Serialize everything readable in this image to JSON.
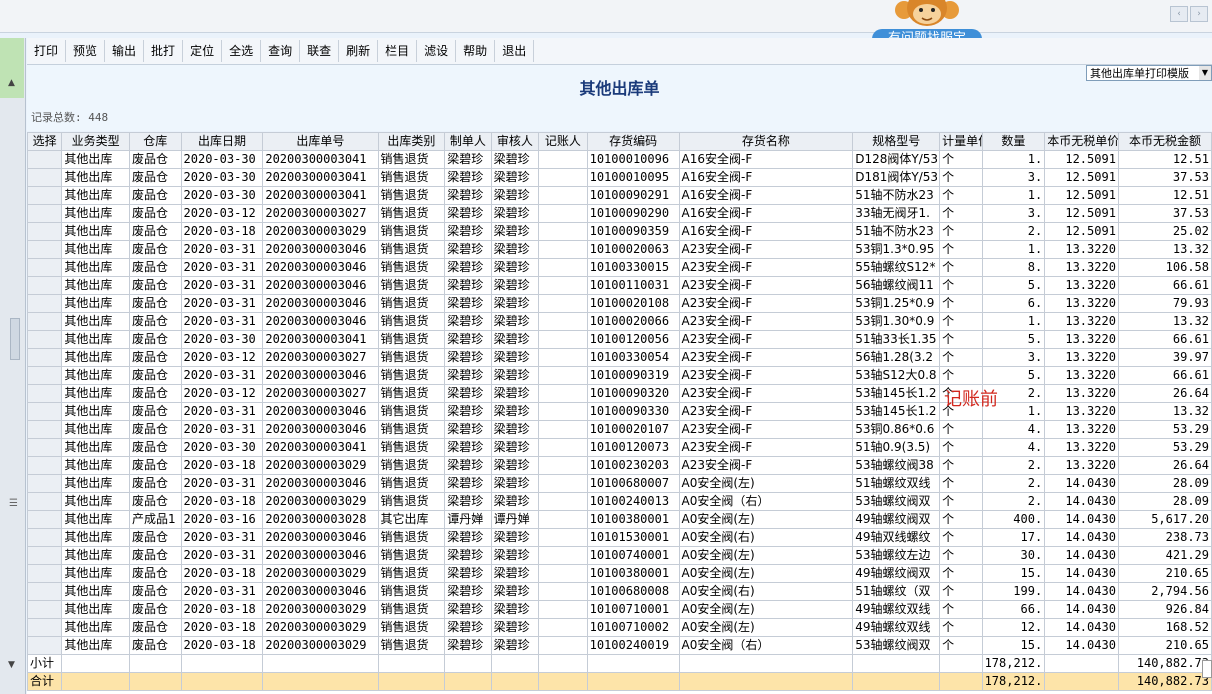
{
  "app": {
    "help_label": "有问题找服宝",
    "nav_prev": "‹",
    "nav_next": "›"
  },
  "toolbar": {
    "buttons": [
      "打印",
      "预览",
      "输出",
      "批打",
      "定位",
      "全选",
      "查询",
      "联查",
      "刷新",
      "栏目",
      "滤设",
      "帮助",
      "退出"
    ]
  },
  "report": {
    "title": "其他出库单",
    "template": "其他出库单打印模版",
    "record_count": "记录总数: 448"
  },
  "table": {
    "columns": [
      "选择",
      "业务类型",
      "仓库",
      "出库日期",
      "出库单号",
      "出库类别",
      "制单人",
      "审核人",
      "记账人",
      "存货编码",
      "存货名称",
      "规格型号",
      "计量单位",
      "数量",
      "本币无税单价",
      "本币无税金额"
    ],
    "rows": [
      [
        "",
        "其他出库",
        "废品仓",
        "2020-03-30",
        "20200300003041",
        "销售退货",
        "梁碧珍",
        "梁碧珍",
        "",
        "10100010096",
        "A16安全阀-F",
        "D128阀体Y/53",
        "个",
        "1.",
        "12.5091",
        "12.51"
      ],
      [
        "",
        "其他出库",
        "废品仓",
        "2020-03-30",
        "20200300003041",
        "销售退货",
        "梁碧珍",
        "梁碧珍",
        "",
        "10100010095",
        "A16安全阀-F",
        "D181阀体Y/53",
        "个",
        "3.",
        "12.5091",
        "37.53"
      ],
      [
        "",
        "其他出库",
        "废品仓",
        "2020-03-30",
        "20200300003041",
        "销售退货",
        "梁碧珍",
        "梁碧珍",
        "",
        "10100090291",
        "A16安全阀-F",
        "51轴不防水23",
        "个",
        "1.",
        "12.5091",
        "12.51"
      ],
      [
        "",
        "其他出库",
        "废品仓",
        "2020-03-12",
        "20200300003027",
        "销售退货",
        "梁碧珍",
        "梁碧珍",
        "",
        "10100090290",
        "A16安全阀-F",
        "33轴无阀牙1.",
        "个",
        "3.",
        "12.5091",
        "37.53"
      ],
      [
        "",
        "其他出库",
        "废品仓",
        "2020-03-18",
        "20200300003029",
        "销售退货",
        "梁碧珍",
        "梁碧珍",
        "",
        "10100090359",
        "A16安全阀-F",
        "51轴不防水23",
        "个",
        "2.",
        "12.5091",
        "25.02"
      ],
      [
        "",
        "其他出库",
        "废品仓",
        "2020-03-31",
        "20200300003046",
        "销售退货",
        "梁碧珍",
        "梁碧珍",
        "",
        "10100020063",
        "A23安全阀-F",
        "53铜1.3*0.95",
        "个",
        "1.",
        "13.3220",
        "13.32"
      ],
      [
        "",
        "其他出库",
        "废品仓",
        "2020-03-31",
        "20200300003046",
        "销售退货",
        "梁碧珍",
        "梁碧珍",
        "",
        "10100330015",
        "A23安全阀-F",
        "55轴螺纹S12*",
        "个",
        "8.",
        "13.3220",
        "106.58"
      ],
      [
        "",
        "其他出库",
        "废品仓",
        "2020-03-31",
        "20200300003046",
        "销售退货",
        "梁碧珍",
        "梁碧珍",
        "",
        "10100110031",
        "A23安全阀-F",
        "56轴螺纹阀11",
        "个",
        "5.",
        "13.3220",
        "66.61"
      ],
      [
        "",
        "其他出库",
        "废品仓",
        "2020-03-31",
        "20200300003046",
        "销售退货",
        "梁碧珍",
        "梁碧珍",
        "",
        "10100020108",
        "A23安全阀-F",
        "53铜1.25*0.9",
        "个",
        "6.",
        "13.3220",
        "79.93"
      ],
      [
        "",
        "其他出库",
        "废品仓",
        "2020-03-31",
        "20200300003046",
        "销售退货",
        "梁碧珍",
        "梁碧珍",
        "",
        "10100020066",
        "A23安全阀-F",
        "53铜1.30*0.9",
        "个",
        "1.",
        "13.3220",
        "13.32"
      ],
      [
        "",
        "其他出库",
        "废品仓",
        "2020-03-30",
        "20200300003041",
        "销售退货",
        "梁碧珍",
        "梁碧珍",
        "",
        "10100120056",
        "A23安全阀-F",
        "51轴33长1.35",
        "个",
        "5.",
        "13.3220",
        "66.61"
      ],
      [
        "",
        "其他出库",
        "废品仓",
        "2020-03-12",
        "20200300003027",
        "销售退货",
        "梁碧珍",
        "梁碧珍",
        "",
        "10100330054",
        "A23安全阀-F",
        "56轴1.28(3.2",
        "个",
        "3.",
        "13.3220",
        "39.97"
      ],
      [
        "",
        "其他出库",
        "废品仓",
        "2020-03-31",
        "20200300003046",
        "销售退货",
        "梁碧珍",
        "梁碧珍",
        "",
        "10100090319",
        "A23安全阀-F",
        "53轴S12大0.8",
        "个",
        "5.",
        "13.3220",
        "66.61"
      ],
      [
        "",
        "其他出库",
        "废品仓",
        "2020-03-12",
        "20200300003027",
        "销售退货",
        "梁碧珍",
        "梁碧珍",
        "",
        "10100090320",
        "A23安全阀-F",
        "53轴145长1.2",
        "个",
        "2.",
        "13.3220",
        "26.64"
      ],
      [
        "",
        "其他出库",
        "废品仓",
        "2020-03-31",
        "20200300003046",
        "销售退货",
        "梁碧珍",
        "梁碧珍",
        "",
        "10100090330",
        "A23安全阀-F",
        "53轴145长1.2",
        "个",
        "1.",
        "13.3220",
        "13.32"
      ],
      [
        "",
        "其他出库",
        "废品仓",
        "2020-03-31",
        "20200300003046",
        "销售退货",
        "梁碧珍",
        "梁碧珍",
        "",
        "10100020107",
        "A23安全阀-F",
        "53铜0.86*0.6",
        "个",
        "4.",
        "13.3220",
        "53.29"
      ],
      [
        "",
        "其他出库",
        "废品仓",
        "2020-03-30",
        "20200300003041",
        "销售退货",
        "梁碧珍",
        "梁碧珍",
        "",
        "10100120073",
        "A23安全阀-F",
        "51轴0.9(3.5)",
        "个",
        "4.",
        "13.3220",
        "53.29"
      ],
      [
        "",
        "其他出库",
        "废品仓",
        "2020-03-18",
        "20200300003029",
        "销售退货",
        "梁碧珍",
        "梁碧珍",
        "",
        "10100230203",
        "A23安全阀-F",
        "53轴螺纹阀38",
        "个",
        "2.",
        "13.3220",
        "26.64"
      ],
      [
        "",
        "其他出库",
        "废品仓",
        "2020-03-31",
        "20200300003046",
        "销售退货",
        "梁碧珍",
        "梁碧珍",
        "",
        "10100680007",
        "A0安全阀(左)",
        "51轴螺纹双线",
        "个",
        "2.",
        "14.0430",
        "28.09"
      ],
      [
        "",
        "其他出库",
        "废品仓",
        "2020-03-18",
        "20200300003029",
        "销售退货",
        "梁碧珍",
        "梁碧珍",
        "",
        "10100240013",
        "A0安全阀（右）",
        "53轴螺纹阀双",
        "个",
        "2.",
        "14.0430",
        "28.09"
      ],
      [
        "",
        "其他出库",
        "产成品1",
        "2020-03-16",
        "20200300003028",
        "其它出库",
        "谭丹婵",
        "谭丹婵",
        "",
        "10100380001",
        "A0安全阀(左)",
        "49轴螺纹阀双",
        "个",
        "400.",
        "14.0430",
        "5,617.20"
      ],
      [
        "",
        "其他出库",
        "废品仓",
        "2020-03-31",
        "20200300003046",
        "销售退货",
        "梁碧珍",
        "梁碧珍",
        "",
        "10101530001",
        "A0安全阀(右)",
        "49轴双线螺纹",
        "个",
        "17.",
        "14.0430",
        "238.73"
      ],
      [
        "",
        "其他出库",
        "废品仓",
        "2020-03-31",
        "20200300003046",
        "销售退货",
        "梁碧珍",
        "梁碧珍",
        "",
        "10100740001",
        "A0安全阀(左)",
        "53轴螺纹左边",
        "个",
        "30.",
        "14.0430",
        "421.29"
      ],
      [
        "",
        "其他出库",
        "废品仓",
        "2020-03-18",
        "20200300003029",
        "销售退货",
        "梁碧珍",
        "梁碧珍",
        "",
        "10100380001",
        "A0安全阀(左)",
        "49轴螺纹阀双",
        "个",
        "15.",
        "14.0430",
        "210.65"
      ],
      [
        "",
        "其他出库",
        "废品仓",
        "2020-03-31",
        "20200300003046",
        "销售退货",
        "梁碧珍",
        "梁碧珍",
        "",
        "10100680008",
        "A0安全阀(右)",
        "51轴螺纹（双",
        "个",
        "199.",
        "14.0430",
        "2,794.56"
      ],
      [
        "",
        "其他出库",
        "废品仓",
        "2020-03-18",
        "20200300003029",
        "销售退货",
        "梁碧珍",
        "梁碧珍",
        "",
        "10100710001",
        "A0安全阀(左)",
        "49轴螺纹双线",
        "个",
        "66.",
        "14.0430",
        "926.84"
      ],
      [
        "",
        "其他出库",
        "废品仓",
        "2020-03-18",
        "20200300003029",
        "销售退货",
        "梁碧珍",
        "梁碧珍",
        "",
        "10100710002",
        "A0安全阀(左)",
        "49轴螺纹双线",
        "个",
        "12.",
        "14.0430",
        "168.52"
      ],
      [
        "",
        "其他出库",
        "废品仓",
        "2020-03-18",
        "20200300003029",
        "销售退货",
        "梁碧珍",
        "梁碧珍",
        "",
        "10100240019",
        "A0安全阀（右）",
        "53轴螺纹阀双",
        "个",
        "15.",
        "14.0430",
        "210.65"
      ]
    ],
    "subtotal": {
      "label": "小计",
      "qty": "178,212.",
      "amount": "140,882.73"
    },
    "total": {
      "label": "合计",
      "qty": "178,212.",
      "amount": "140,882.73"
    }
  },
  "annotation": "记账前"
}
